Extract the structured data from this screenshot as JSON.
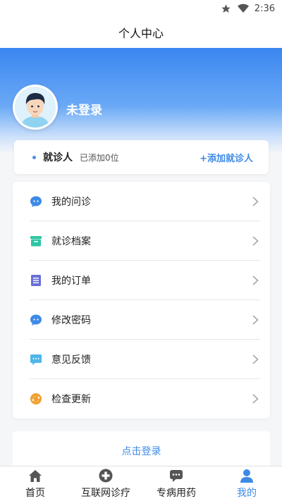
{
  "status_bar": {
    "time": "2:36"
  },
  "header": {
    "title": "个人中心"
  },
  "profile": {
    "name": "未登录"
  },
  "patient": {
    "label": "就诊人",
    "count": "已添加0位",
    "add_label": "+添加就诊人"
  },
  "menu": {
    "items": [
      {
        "label": "我的问诊",
        "icon": "chat-bubble-icon",
        "color": "#3d8ae6"
      },
      {
        "label": "就诊档案",
        "icon": "archive-box-icon",
        "color": "#2ec6a4"
      },
      {
        "label": "我的订单",
        "icon": "order-list-icon",
        "color": "#6a6fd8"
      },
      {
        "label": "修改密码",
        "icon": "chat-bubble-icon",
        "color": "#3d8ae6"
      },
      {
        "label": "意见反馈",
        "icon": "feedback-message-icon",
        "color": "#4fb6ea"
      },
      {
        "label": "检查更新",
        "icon": "refresh-update-icon",
        "color": "#f0a030"
      }
    ]
  },
  "login_button": {
    "label": "点击登录"
  },
  "tabs": [
    {
      "label": "首页",
      "icon": "home-icon",
      "active": false
    },
    {
      "label": "互联网诊疗",
      "icon": "medical-cross-icon",
      "active": false
    },
    {
      "label": "专病用药",
      "icon": "message-bubble-icon",
      "active": false
    },
    {
      "label": "我的",
      "icon": "user-icon",
      "active": true
    }
  ],
  "colors": {
    "accent": "#3d8ae6",
    "hero_top": "#3a86f0",
    "background": "#f5f6f8"
  }
}
